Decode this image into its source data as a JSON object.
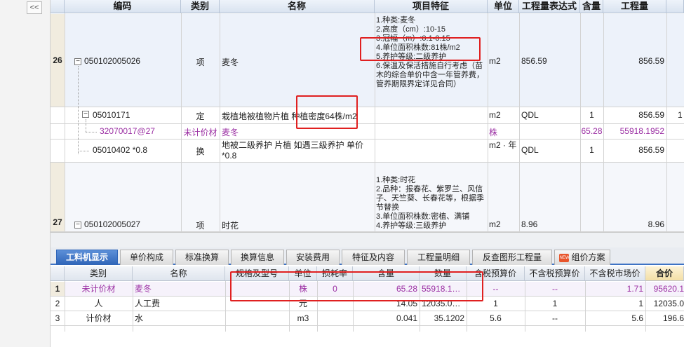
{
  "ui": {
    "collapse_glyph": "<<"
  },
  "top_table": {
    "headers": {
      "code": "编码",
      "category": "类别",
      "name": "名称",
      "feature": "项目特征",
      "unit": "单位",
      "quantity_expr": "工程量表达式",
      "content": "含量",
      "quantity": "工程量"
    },
    "rows": {
      "r26": {
        "rownum": "26",
        "code": "050102005026",
        "category": "项",
        "name": "麦冬",
        "feature": [
          "1.种类:麦冬",
          "2.高度（cm）:10-15",
          "3.冠幅（m）:0.1-0.15",
          "4.单位面积株数:81株/m2",
          "5.养护等级:二级养护",
          "6.保温及保活措施自行考虑（苗木的综合单价中含一年管养费，管养期限界定详见合同）"
        ],
        "unit": "m2",
        "quantity_expr": "856.59",
        "quantity": "856.59"
      },
      "r_def": {
        "code": "05010171",
        "category": "定",
        "name": "栽植地被植物片植 种植密度64株/m2",
        "unit": "m2",
        "quantity_expr": "QDL",
        "content": "1",
        "quantity": "856.59",
        "extra": "1"
      },
      "r_mat": {
        "code": "32070017@27",
        "category": "未计价材",
        "name": "麦冬",
        "unit": "株",
        "content": "65.28",
        "quantity": "55918.1952"
      },
      "r_conv": {
        "code": "05010402 *0.8",
        "category": "换",
        "name": "地被二级养护 片植  如遇三级养护 单价*0.8",
        "unit": "m2 · 年",
        "quantity_expr": "QDL",
        "content": "1",
        "quantity": "856.59"
      },
      "r27": {
        "rownum": "27",
        "code": "050102005027",
        "category": "项",
        "name": "时花",
        "feature": [
          "1.种类:时花",
          "2.品种：报春花、紫罗兰、风信子、天竺葵、长春花等，根据季节替换",
          "3.单位面积株数:密植、满铺",
          "4.养护等级:三级养护"
        ],
        "unit": "m2",
        "quantity_expr": "8.96",
        "quantity": "8.96"
      }
    }
  },
  "tabs": {
    "t1": "工料机显示",
    "t2": "单价构成",
    "t3": "标准换算",
    "t4": "换算信息",
    "t5": "安装费用",
    "t6": "特征及内容",
    "t7": "工程量明细",
    "t8": "反查图形工程量",
    "t9": "组价方案",
    "new_badge": "NEW"
  },
  "bottom_table": {
    "headers": {
      "category": "类别",
      "name": "名称",
      "spec": "规格及型号",
      "unit": "单位",
      "loss": "损耗率",
      "content": "含量",
      "quantity": "数量",
      "tax_price": "含税预算价",
      "notax_price": "不含税预算价",
      "market_price": "不含税市场价",
      "total": "合价"
    },
    "rows": {
      "b1": {
        "idx": "1",
        "category": "未计价材",
        "name": "麦冬",
        "unit": "株",
        "loss": "0",
        "content": "65.28",
        "quantity": "55918.1…",
        "tax_price": "--",
        "notax_price": "--",
        "market_price": "1.71",
        "total": "95620.1"
      },
      "b2": {
        "idx": "2",
        "category": "人",
        "name": "人工费",
        "unit": "元",
        "content": "14.05",
        "quantity": "12035.0…",
        "tax_price": "1",
        "notax_price": "1",
        "market_price": "1",
        "total": "12035.0"
      },
      "b3": {
        "idx": "3",
        "category": "计价材",
        "name": "水",
        "unit": "m3",
        "content": "0.041",
        "quantity": "35.1202",
        "tax_price": "5.6",
        "notax_price": "--",
        "market_price": "5.6",
        "total": "196.6"
      }
    }
  },
  "colors": {
    "accent": "#2f65b8",
    "purple_text": "#9b2fa3",
    "highlight_box": "#e02020"
  }
}
